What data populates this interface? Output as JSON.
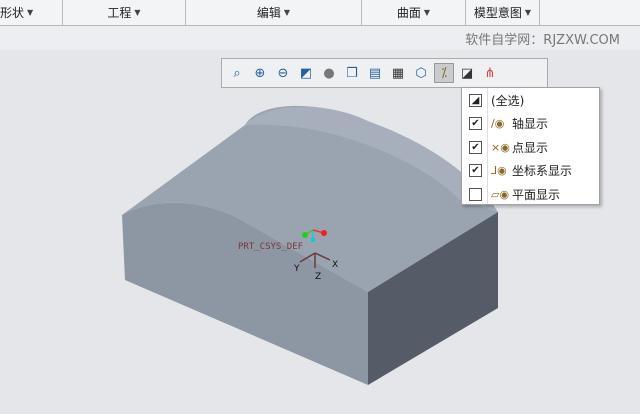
{
  "ribbon": {
    "groups": [
      "形状",
      "工程",
      "编辑",
      "曲面",
      "模型意图"
    ]
  },
  "watermark": "软件自学网：RJZXW.COM",
  "toolbar": {
    "icons": [
      "refit-icon",
      "zoom-in-icon",
      "zoom-out-icon",
      "reorient-icon",
      "display-style-icon",
      "saved-views-icon",
      "view-manager-icon",
      "appearance-icon",
      "perspective-icon",
      "datum-display-filter-icon",
      "annotation-display-icon",
      "spin-center-icon"
    ]
  },
  "menu": {
    "items": [
      {
        "label": "(全选)",
        "state": "partial",
        "icon": "select-all"
      },
      {
        "label": "轴显示",
        "state": "checked",
        "icon": "axis-display-icon"
      },
      {
        "label": "点显示",
        "state": "checked",
        "icon": "point-display-icon"
      },
      {
        "label": "坐标系显示",
        "state": "checked",
        "icon": "csys-display-icon"
      },
      {
        "label": "平面显示",
        "state": "unchecked",
        "icon": "plane-display-icon"
      }
    ]
  },
  "model": {
    "csys_label": "PRT_CSYS_DEF",
    "axes": [
      "Y",
      "Z",
      "X"
    ]
  }
}
